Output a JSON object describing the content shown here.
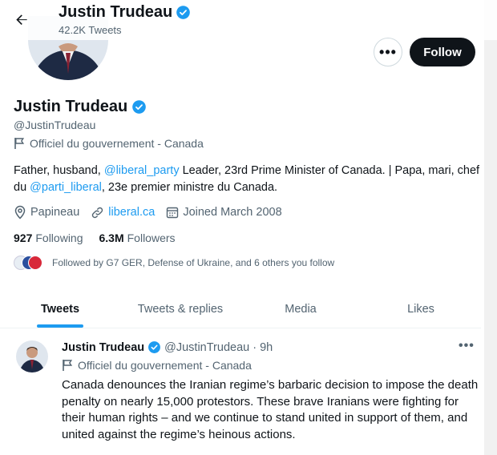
{
  "header": {
    "name": "Justin Trudeau",
    "tweet_count": "42.2K Tweets"
  },
  "actions": {
    "more_label": "•••",
    "follow_label": "Follow"
  },
  "profile": {
    "name": "Justin Trudeau",
    "handle": "@JustinTrudeau",
    "gov_label": "Officiel du gouvernement - Canada",
    "bio": {
      "part1": "Father, husband, ",
      "link1": "@liberal_party",
      "part2": " Leader, 23rd Prime Minister of Canada. | Papa, mari, chef du ",
      "link2": "@parti_liberal",
      "part3": ", 23e premier ministre du Canada."
    },
    "location": "Papineau",
    "website": "liberal.ca",
    "joined": "Joined March 2008",
    "following_count": "927",
    "following_label": "Following",
    "followers_count": "6.3M",
    "followers_label": "Followers",
    "followed_by": "Followed by G7 GER, Defense of Ukraine, and 6 others you follow"
  },
  "tabs": [
    {
      "label": "Tweets",
      "active": true
    },
    {
      "label": "Tweets & replies",
      "active": false
    },
    {
      "label": "Media",
      "active": false
    },
    {
      "label": "Likes",
      "active": false
    }
  ],
  "tweet": {
    "name": "Justin Trudeau",
    "handle_time": "@JustinTrudeau · 9h",
    "gov_label": "Officiel du gouvernement - Canada",
    "more_label": "•••",
    "text": "Canada denounces the Iranian regime’s barbaric decision to impose the death penalty on nearly 15,000 protestors. These brave Iranians were fighting for their human rights – and we continue to stand united in support of them, and united against the regime’s heinous actions."
  },
  "colors": {
    "accent": "#1d9bf0",
    "text_primary": "#0f1419",
    "text_secondary": "#536471",
    "verified": "#1d9bf0"
  },
  "icons": [
    "back-arrow-icon",
    "verified-badge-icon",
    "flag-icon",
    "location-pin-icon",
    "link-icon",
    "calendar-icon",
    "more-icon"
  ]
}
